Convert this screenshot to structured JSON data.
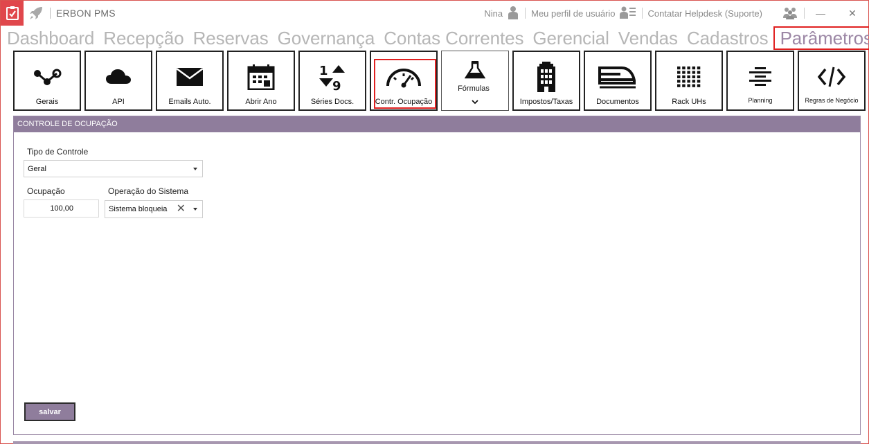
{
  "titlebar": {
    "app_title": "ERBON PMS",
    "user_name": "Nina",
    "profile_label": "Meu perfil de usuário",
    "helpdesk_label": "Contatar Helpdesk (Suporte)",
    "minimize": "—",
    "close": "✕"
  },
  "menu": {
    "items": [
      "Dashboard",
      "Recepção",
      "Reservas",
      "Governança",
      "Contas Correntes",
      "Gerencial",
      "Vendas",
      "Cadastros",
      "Parâmetros"
    ],
    "active": "Parâmetros"
  },
  "tiles": [
    {
      "label": "Gerais",
      "icon": "share-icon"
    },
    {
      "label": "API",
      "icon": "cloud-icon"
    },
    {
      "label": "Emails Auto.",
      "icon": "envelope-icon"
    },
    {
      "label": "Abrir Ano",
      "icon": "calendar-icon"
    },
    {
      "label": "Séries Docs.",
      "icon": "sort-numeric-icon"
    },
    {
      "label": "Contr. Ocupação",
      "icon": "gauge-icon"
    },
    {
      "label": "Fórmulas",
      "icon": "flask-icon"
    },
    {
      "label": "Impostos/Taxas",
      "icon": "building-icon"
    },
    {
      "label": "Documentos",
      "icon": "train-icon"
    },
    {
      "label": "Rack UHs",
      "icon": "grid-icon"
    },
    {
      "label": "Planning",
      "icon": "lines-icon"
    },
    {
      "label": "Regras de Negócio",
      "icon": "code-icon"
    }
  ],
  "panel": {
    "title": "CONTROLE DE OCUPAÇÃO",
    "tipo_label": "Tipo de Controle",
    "tipo_value": "Geral",
    "ocupacao_label": "Ocupação",
    "ocupacao_value": "100,00",
    "operacao_label": "Operação do Sistema",
    "operacao_value": "Sistema bloqueia",
    "save_label": "salvar"
  },
  "colors": {
    "accent": "#8f7d9c",
    "app_icon_bg": "#e0474c",
    "highlight": "#e02020"
  }
}
